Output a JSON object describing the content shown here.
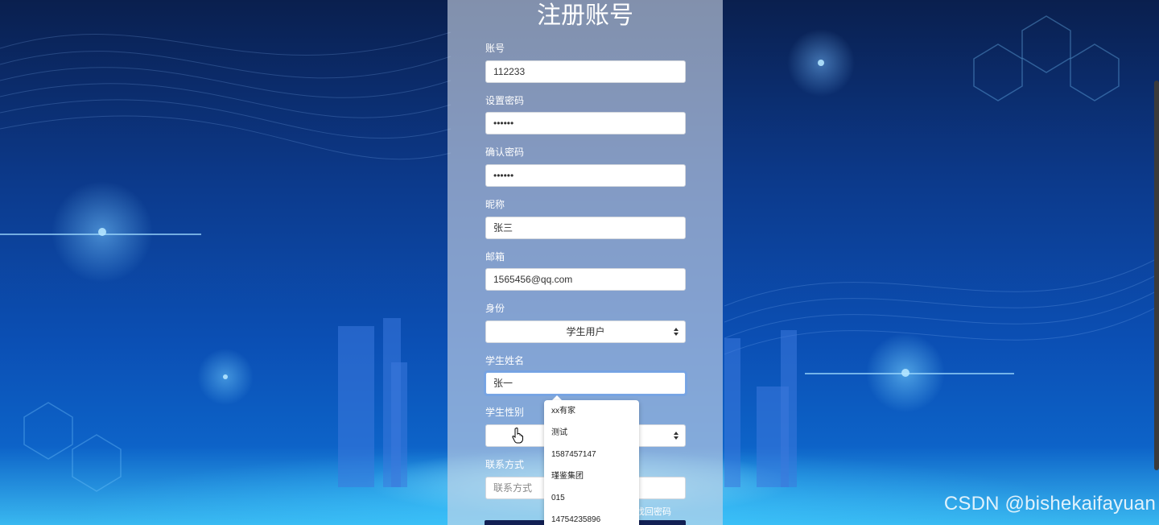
{
  "form": {
    "title": "注册账号",
    "account": {
      "label": "账号",
      "value": "112233"
    },
    "password": {
      "label": "设置密码",
      "value": "••••••"
    },
    "confirm_password": {
      "label": "确认密码",
      "value": "••••••"
    },
    "nickname": {
      "label": "昵称",
      "value": "张三"
    },
    "email": {
      "label": "邮箱",
      "value": "1565456@qq.com"
    },
    "identity": {
      "label": "身份",
      "value": "学生用户"
    },
    "student_name": {
      "label": "学生姓名",
      "value": "张一"
    },
    "student_gender": {
      "label": "学生性别"
    },
    "contact": {
      "label": "联系方式",
      "placeholder": "联系方式"
    },
    "forgot_link": "找回密码"
  },
  "autocomplete": {
    "items": [
      "xx有家",
      "测试",
      "1587457147",
      "瑾鉴集团",
      "015",
      "14754235896"
    ]
  },
  "watermark": "CSDN @bishekaifayuan"
}
